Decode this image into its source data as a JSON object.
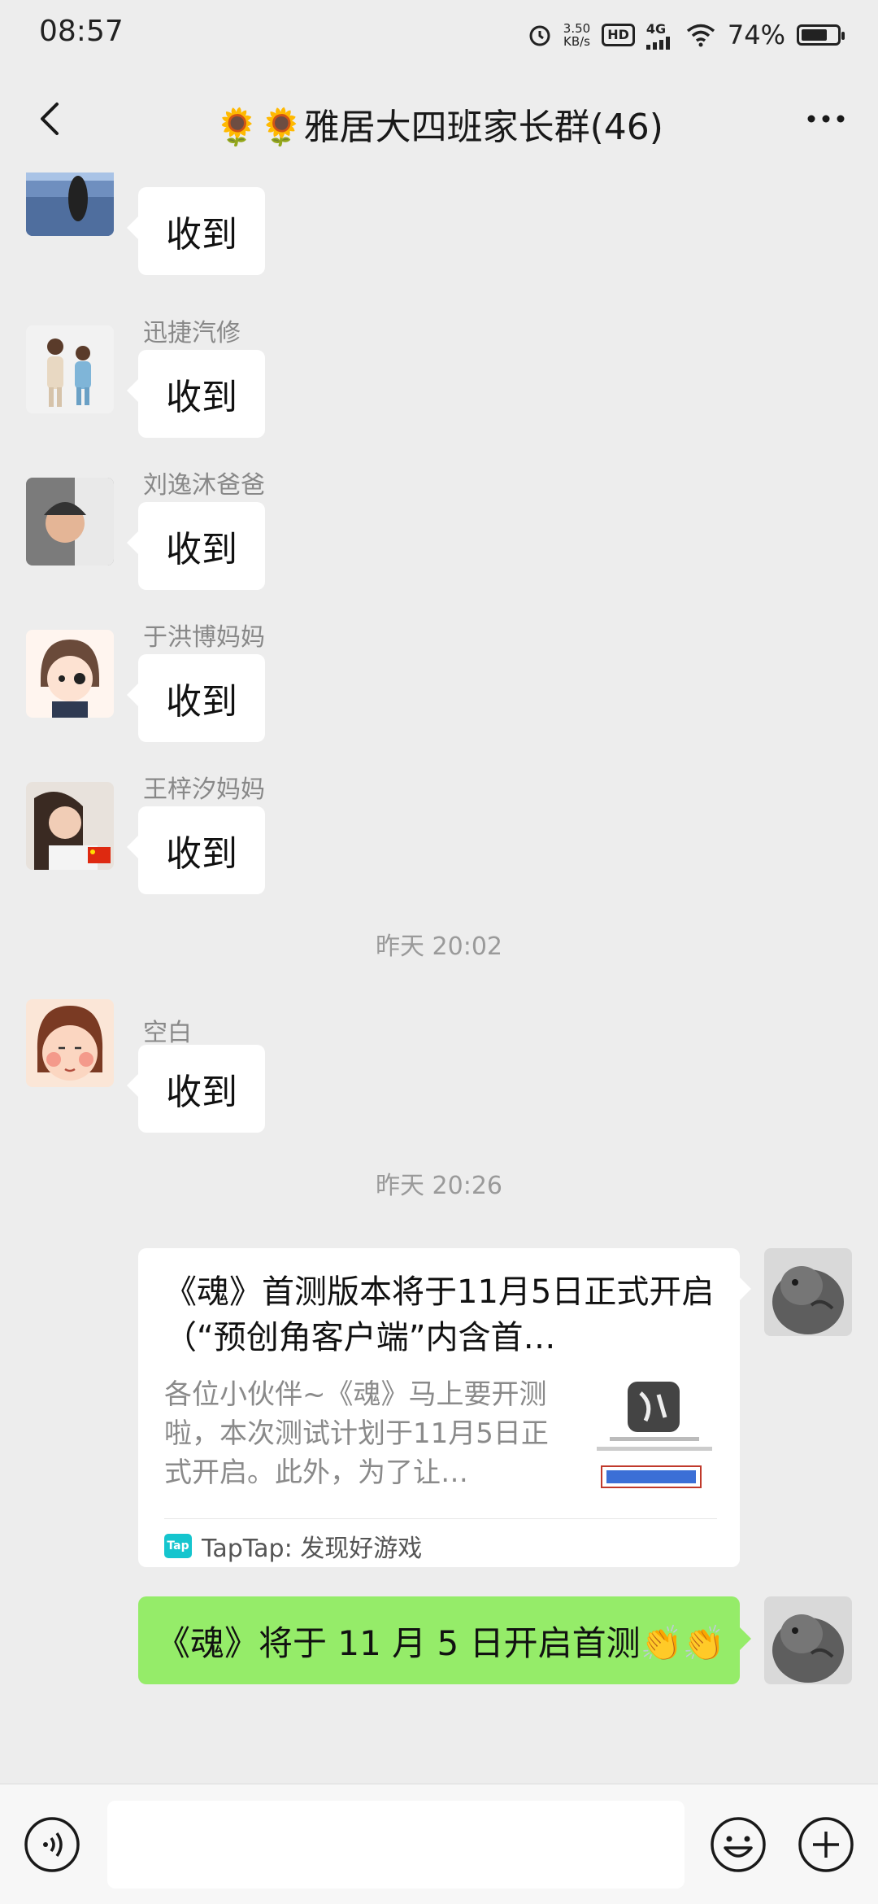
{
  "status_bar": {
    "time": "08:57",
    "speed_value": "3.50",
    "speed_unit": "KB/s",
    "hd": "HD",
    "network": "4G",
    "battery_text": "74%",
    "battery_level": 0.74
  },
  "header": {
    "title": "🌻🌻雅居大四班家长群(46)"
  },
  "messages": [
    {
      "sender": "",
      "text": "收到"
    },
    {
      "sender": "迅捷汽修",
      "text": "收到"
    },
    {
      "sender": "刘逸沐爸爸",
      "text": "收到"
    },
    {
      "sender": "于洪博妈妈",
      "text": "收到"
    },
    {
      "sender": "王梓汐妈妈",
      "text": "收到"
    },
    {
      "sender": "空白",
      "text": "收到"
    }
  ],
  "timestamps": [
    "昨天 20:02",
    "昨天 20:26"
  ],
  "link_card": {
    "title": "《魂》首测版本将于11月5日正式开启（“预创角客户端”内含首…",
    "description": "各位小伙伴~《魂》马上要开测啦，本次测试计划于11月5日正式开启。此外，为了让…",
    "source_icon": "Tap",
    "source": "TapTap: 发现好游戏"
  },
  "own_message": {
    "text": "《魂》将于 11 月 5 日开启首测👏👏"
  },
  "input_bar": {
    "voice_icon": "voice-icon",
    "emoji_icon": "emoji-icon",
    "plus_icon": "plus-icon"
  }
}
